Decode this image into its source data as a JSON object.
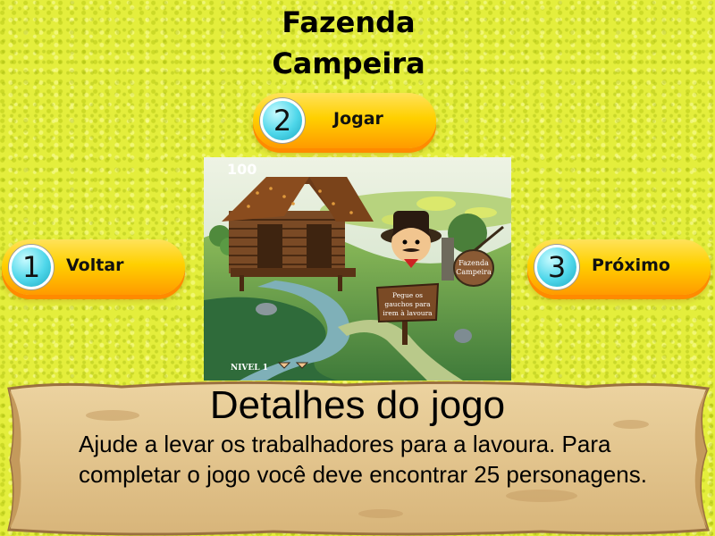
{
  "page": {
    "title_line1": "Fazenda",
    "title_line2": "Campeira"
  },
  "buttons": {
    "play": {
      "number": "2",
      "label": "Jogar"
    },
    "back": {
      "number": "1",
      "label": "Voltar"
    },
    "next": {
      "number": "3",
      "label": "Próximo"
    }
  },
  "game_preview": {
    "score": "100",
    "sign_text_lines": [
      "Pegue os",
      "gauchos para",
      "irem à lavoura"
    ],
    "farm_sign_lines": [
      "Fazenda",
      "Campeira"
    ],
    "level": "NIVEL 1",
    "life_icons": [
      "gaucho-icon",
      "gaucho-icon"
    ]
  },
  "details": {
    "title": "Detalhes do jogo",
    "description": "Ajude a levar os trabalhadores para a lavoura. Para completar o jogo você deve encontrar 25 personagens."
  },
  "colors": {
    "background": "#e4ee3c",
    "button_top": "#ffe25a",
    "button_bottom": "#ff9a00",
    "number_circle": "#4fd7ea",
    "parchment": "#e3c58d"
  }
}
